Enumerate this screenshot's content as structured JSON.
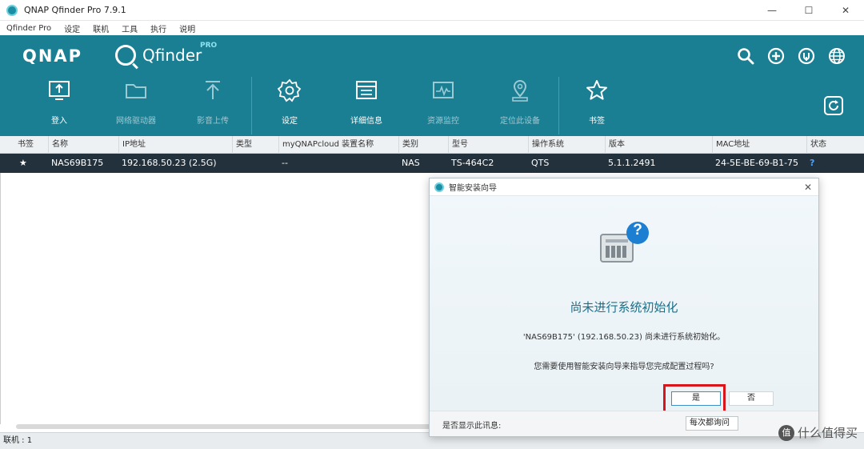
{
  "window": {
    "title": "QNAP Qfinder Pro 7.9.1",
    "controls": [
      "—",
      "☐",
      "✕"
    ]
  },
  "menu": [
    "Qfinder Pro",
    "设定",
    "联机",
    "工具",
    "执行",
    "说明"
  ],
  "header": {
    "qnap_logo": "QNAP",
    "qfinder_logo": "Qfinder",
    "pro_tag": "PRO",
    "top_icons": [
      "search-icon",
      "add-icon",
      "power-icon",
      "globe-icon"
    ]
  },
  "toolbar": {
    "items": [
      {
        "label": "登入",
        "icon": "login-icon",
        "enabled": true
      },
      {
        "label": "网络驱动器",
        "icon": "folder-icon",
        "enabled": false
      },
      {
        "label": "影音上传",
        "icon": "upload-icon",
        "enabled": false
      },
      {
        "label": "设定",
        "icon": "gear-icon",
        "enabled": true
      },
      {
        "label": "详细信息",
        "icon": "details-icon",
        "enabled": true
      },
      {
        "label": "资源监控",
        "icon": "monitor-icon",
        "enabled": false
      },
      {
        "label": "定位此设备",
        "icon": "locate-icon",
        "enabled": false
      },
      {
        "label": "书签",
        "icon": "star-icon",
        "enabled": true
      }
    ],
    "refresh_icon": "refresh-icon"
  },
  "table": {
    "headers": [
      "书签",
      "名称",
      "IP地址",
      "类型",
      "myQNAPcloud 装置名称",
      "类别",
      "型号",
      "操作系统",
      "版本",
      "MAC地址",
      "状态"
    ],
    "rows": [
      {
        "bookmark": "★",
        "name": "NAS69B175",
        "ip": "192.168.50.23 (2.5G)",
        "type": "",
        "cloud_name": "--",
        "category": "NAS",
        "model": "TS-464C2",
        "os": "QTS",
        "version": "5.1.1.2491",
        "mac": "24-5E-BE-69-B1-75",
        "status": "?"
      }
    ]
  },
  "statusbar": {
    "text": "联机 : 1"
  },
  "dialog": {
    "title": "智能安装向导",
    "close": "✕",
    "badge": "?",
    "heading": "尚未进行系统初始化",
    "line1": "'NAS69B175' (192.168.50.23) 尚未进行系统初始化。",
    "line2": "您需要使用智能安装向导来指导您完成配置过程吗?",
    "yes_label": "是",
    "no_label": "否",
    "footer_label": "是否显示此讯息:",
    "footer_select": "每次都询问",
    "colors": {
      "highlight": "#d9141b",
      "accent": "#1b6f8a"
    }
  },
  "watermark": {
    "badge": "值",
    "text": "什么值得买"
  }
}
